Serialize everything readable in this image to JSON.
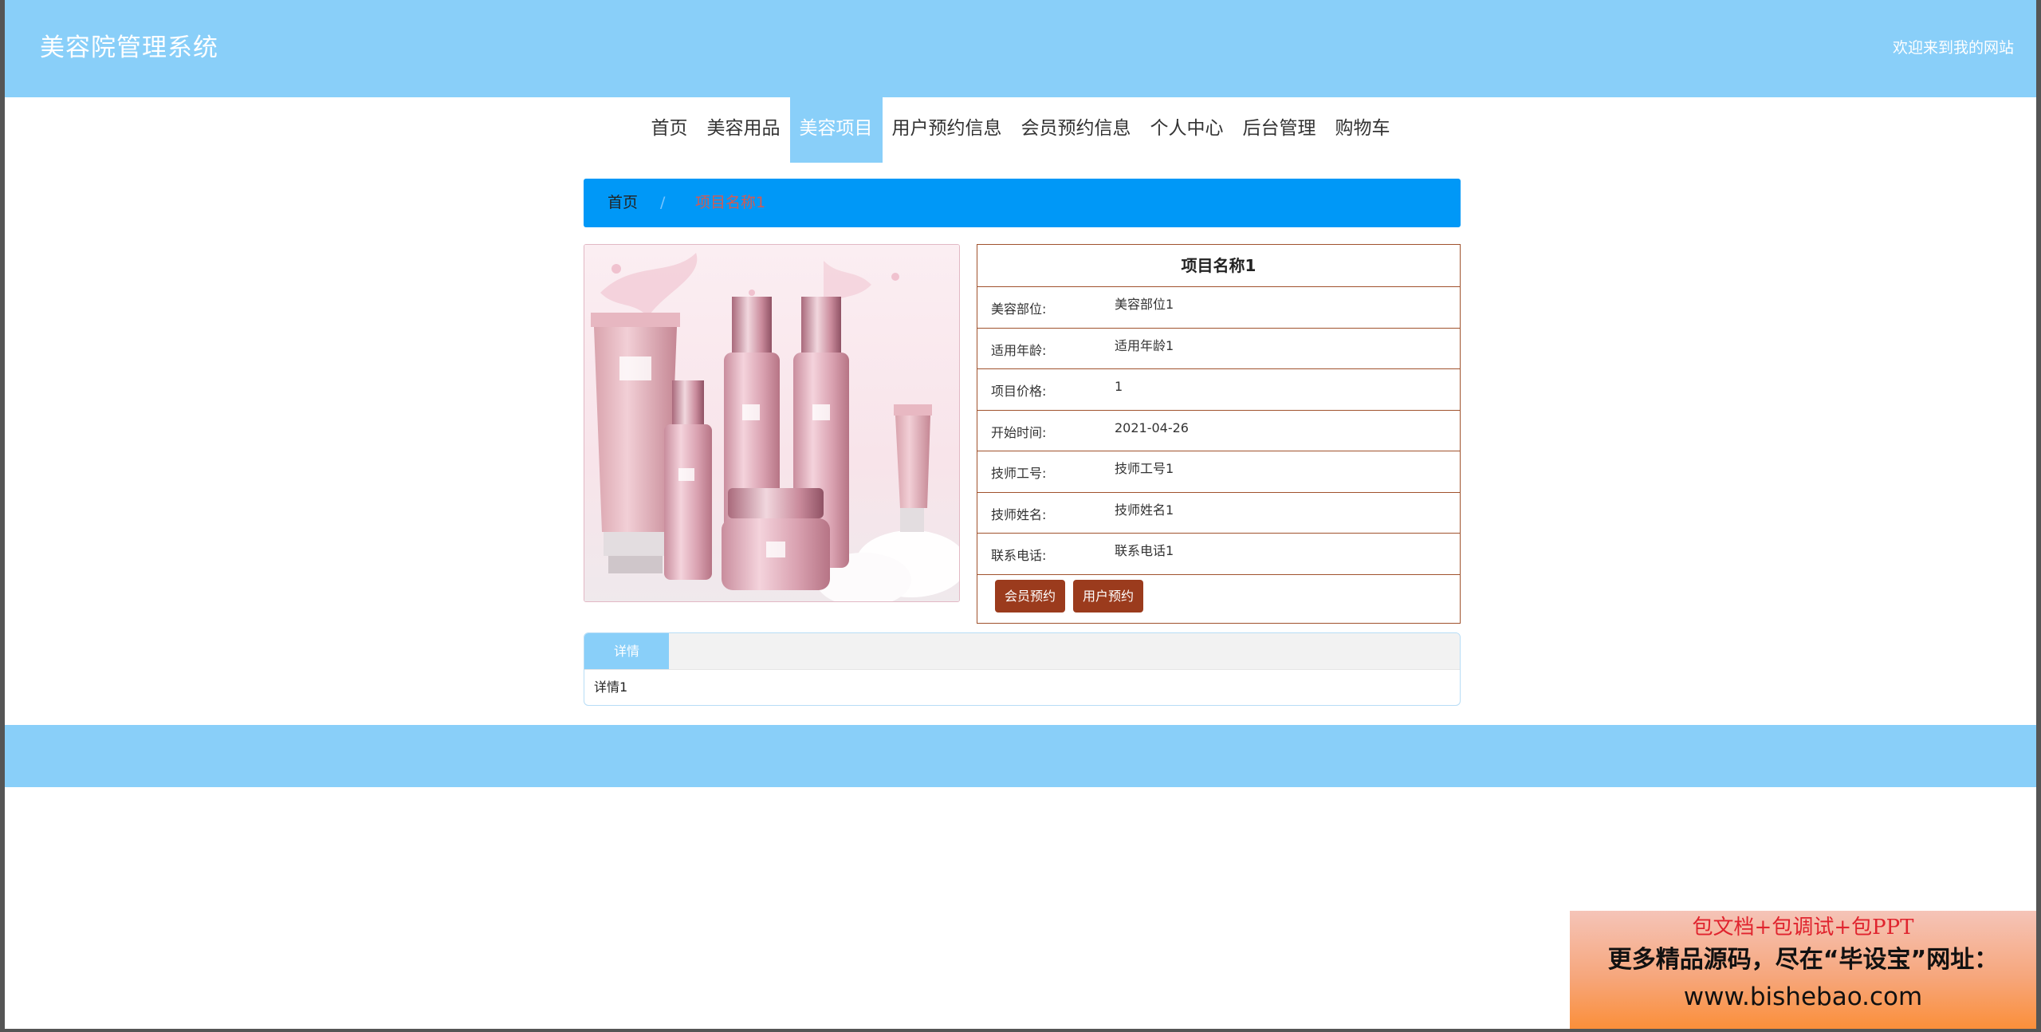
{
  "header": {
    "site_title": "美容院管理系统",
    "welcome": "欢迎来到我的网站"
  },
  "nav": {
    "items": [
      {
        "label": "首页",
        "active": false
      },
      {
        "label": "美容用品",
        "active": false
      },
      {
        "label": "美容项目",
        "active": true
      },
      {
        "label": "用户预约信息",
        "active": false
      },
      {
        "label": "会员预约信息",
        "active": false
      },
      {
        "label": "个人中心",
        "active": false
      },
      {
        "label": "后台管理",
        "active": false
      },
      {
        "label": "购物车",
        "active": false
      }
    ]
  },
  "breadcrumb": {
    "home": "首页",
    "separator": "/",
    "current": "项目名称1"
  },
  "detail": {
    "title": "项目名称1",
    "fields": [
      {
        "label": "美容部位:",
        "value": "美容部位1"
      },
      {
        "label": "适用年龄:",
        "value": "适用年龄1"
      },
      {
        "label": "项目价格:",
        "value": "1"
      },
      {
        "label": "开始时间:",
        "value": "2021-04-26"
      },
      {
        "label": "技师工号:",
        "value": "技师工号1"
      },
      {
        "label": "技师姓名:",
        "value": "技师姓名1"
      },
      {
        "label": "联系电话:",
        "value": "联系电话1"
      }
    ],
    "member_booking_button": "会员预约",
    "user_booking_button": "用户预约"
  },
  "tabs": {
    "active_label": "详情",
    "content": "详情1"
  },
  "promo": {
    "line1": "包文档+包调试+包PPT",
    "line2": "更多精品源码，尽在“毕设宝”网址：",
    "line3": "www.bishebao.com"
  },
  "colors": {
    "header_bg": "#89cff9",
    "breadcrumb_bg": "#0098f7",
    "button_bg": "#9b3b1d",
    "table_border": "#a0522d"
  }
}
